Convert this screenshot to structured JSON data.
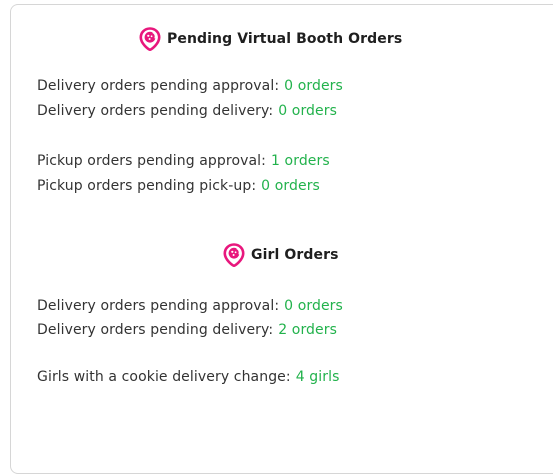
{
  "colors": {
    "accent_green": "#22b24c",
    "icon_pink": "#e8177d",
    "text": "#333333",
    "border": "#d6d6d6"
  },
  "booth": {
    "icon": "map-pin-cookie-icon",
    "title": "Pending Virtual Booth Orders",
    "rows": [
      {
        "label": "Delivery orders pending approval:",
        "value": "0 orders"
      },
      {
        "label": "Delivery orders pending delivery:",
        "value": "0 orders"
      },
      {
        "label": "Pickup orders pending approval:",
        "value": "1 orders"
      },
      {
        "label": "Pickup orders pending pick-up:",
        "value": "0 orders"
      }
    ]
  },
  "girl": {
    "icon": "map-pin-cookie-icon",
    "title": "Girl Orders",
    "rows": [
      {
        "label": "Delivery orders pending approval:",
        "value": "0 orders"
      },
      {
        "label": "Delivery orders pending delivery:",
        "value": "2 orders"
      },
      {
        "label": "Girls with a cookie delivery change:",
        "value": "4 girls"
      }
    ]
  }
}
